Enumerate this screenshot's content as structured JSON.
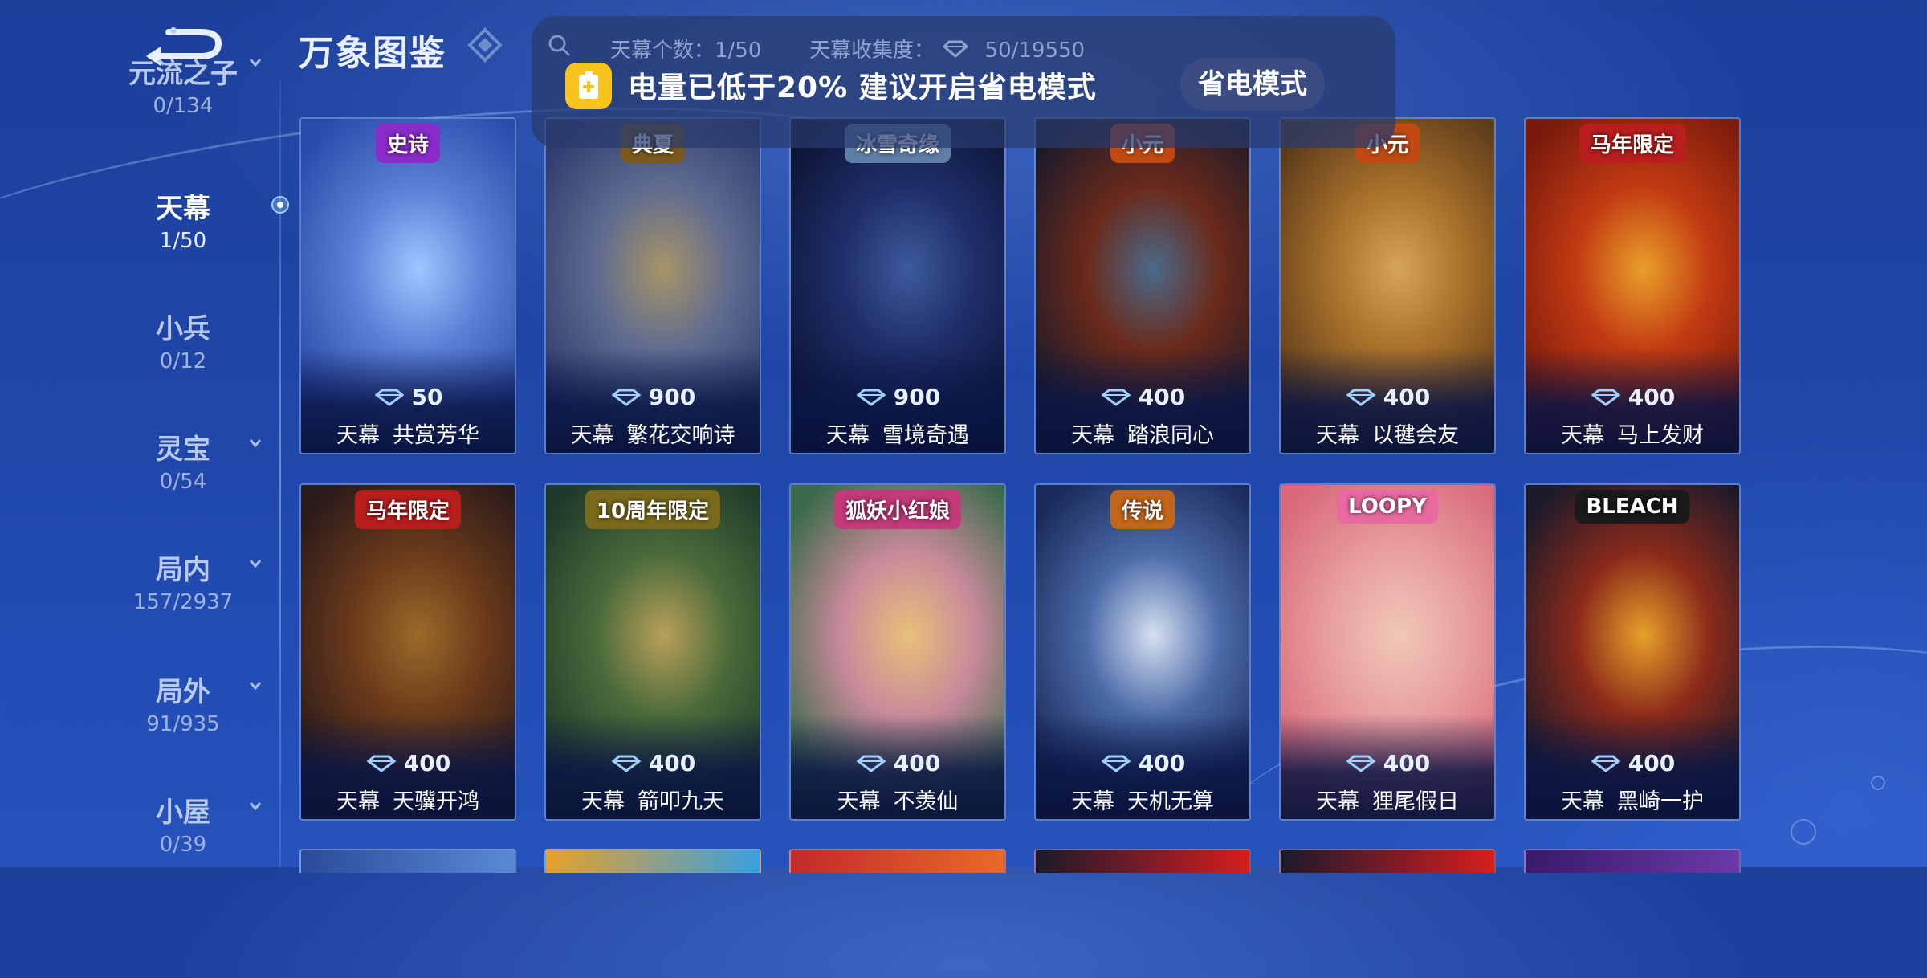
{
  "header": {
    "back_label": "",
    "title": "万象图鉴"
  },
  "sidebar": {
    "items": [
      {
        "name": "元流之子",
        "count": "0/134",
        "active": false,
        "expandable": true
      },
      {
        "name": "天幕",
        "count": "1/50",
        "active": true,
        "expandable": false
      },
      {
        "name": "小兵",
        "count": "0/12",
        "active": false,
        "expandable": false
      },
      {
        "name": "灵宝",
        "count": "0/54",
        "active": false,
        "expandable": true
      },
      {
        "name": "局内",
        "count": "157/2937",
        "active": false,
        "expandable": true
      },
      {
        "name": "局外",
        "count": "91/935",
        "active": false,
        "expandable": true
      },
      {
        "name": "小屋",
        "count": "0/39",
        "active": false,
        "expandable": true
      }
    ]
  },
  "stats": {
    "count_text": "天幕个数：1/50",
    "collect_label": "天幕收集度：",
    "collect_value": "50/19550"
  },
  "notice": {
    "text": "电量已低于20%  建议开启省电模式",
    "button_label": "省电模式",
    "icon": "battery-plus-icon"
  },
  "cards": [
    {
      "tag": "史诗",
      "price": "50",
      "prefix": "天幕",
      "name": "共赏芳华",
      "tag_color": "#8a2cc9",
      "art": [
        "#2a4aa8",
        "#5a7fd6",
        "#9fc6ff"
      ]
    },
    {
      "tag": "典夏",
      "price": "900",
      "prefix": "天幕",
      "name": "繁花交响诗",
      "tag_color": "#7a5a1c",
      "art": [
        "#2f3b6e",
        "#5f6b8f",
        "#a79468"
      ]
    },
    {
      "tag": "冰雪奇缘",
      "price": "900",
      "prefix": "天幕",
      "name": "雪境奇遇",
      "tag_color": "#5f7ea8",
      "art": [
        "#0c1434",
        "#1f2e6a",
        "#3c5a9c"
      ]
    },
    {
      "tag": "小元",
      "price": "400",
      "prefix": "天幕",
      "name": "踏浪同心",
      "tag_color": "#c24a12",
      "art": [
        "#1a1a2a",
        "#6a2a1a",
        "#4a6a8a"
      ]
    },
    {
      "tag": "小元",
      "price": "400",
      "prefix": "天幕",
      "name": "以毽会友",
      "tag_color": "#c24a12",
      "art": [
        "#5a3a1a",
        "#a8702a",
        "#d6a45a"
      ]
    },
    {
      "tag": "马年限定",
      "price": "400",
      "prefix": "天幕",
      "name": "马上发财",
      "tag_color": "#b81e1e",
      "art": [
        "#7a1a0c",
        "#c23a12",
        "#e8a02a"
      ]
    },
    {
      "tag": "马年限定",
      "price": "400",
      "prefix": "天幕",
      "name": "天骥开鸿",
      "tag_color": "#b81e1e",
      "art": [
        "#2a1a1a",
        "#6a3a1a",
        "#9a6a2a"
      ]
    },
    {
      "tag": "10周年限定",
      "price": "400",
      "prefix": "天幕",
      "name": "箭叩九天",
      "tag_color": "#7a6a1c",
      "art": [
        "#1f3a2a",
        "#4a6a3a",
        "#b8a05a"
      ]
    },
    {
      "tag": "狐妖小红娘",
      "price": "400",
      "prefix": "天幕",
      "name": "不羡仙",
      "tag_color": "#c23a7a",
      "art": [
        "#3a6a4a",
        "#c88a9a",
        "#e8c07a"
      ]
    },
    {
      "tag": "传说",
      "price": "400",
      "prefix": "天幕",
      "name": "天机无算",
      "tag_color": "#c2661a",
      "art": [
        "#1a2a5a",
        "#4a6aa8",
        "#d6e0f0"
      ]
    },
    {
      "tag": "LOOPY",
      "price": "400",
      "prefix": "天幕",
      "name": "狸尾假日",
      "tag_color": "#e86aa0",
      "art": [
        "#d86a7a",
        "#e8a0a0",
        "#f0c8b8"
      ]
    },
    {
      "tag": "BLEACH",
      "price": "400",
      "prefix": "天幕",
      "name": "黑崎一护",
      "tag_color": "#1a1a1a",
      "art": [
        "#1a1a2a",
        "#8a2a1a",
        "#e8a02a"
      ]
    }
  ],
  "colors": {
    "accent": "#f7c31c",
    "background": "#1f46a8"
  }
}
